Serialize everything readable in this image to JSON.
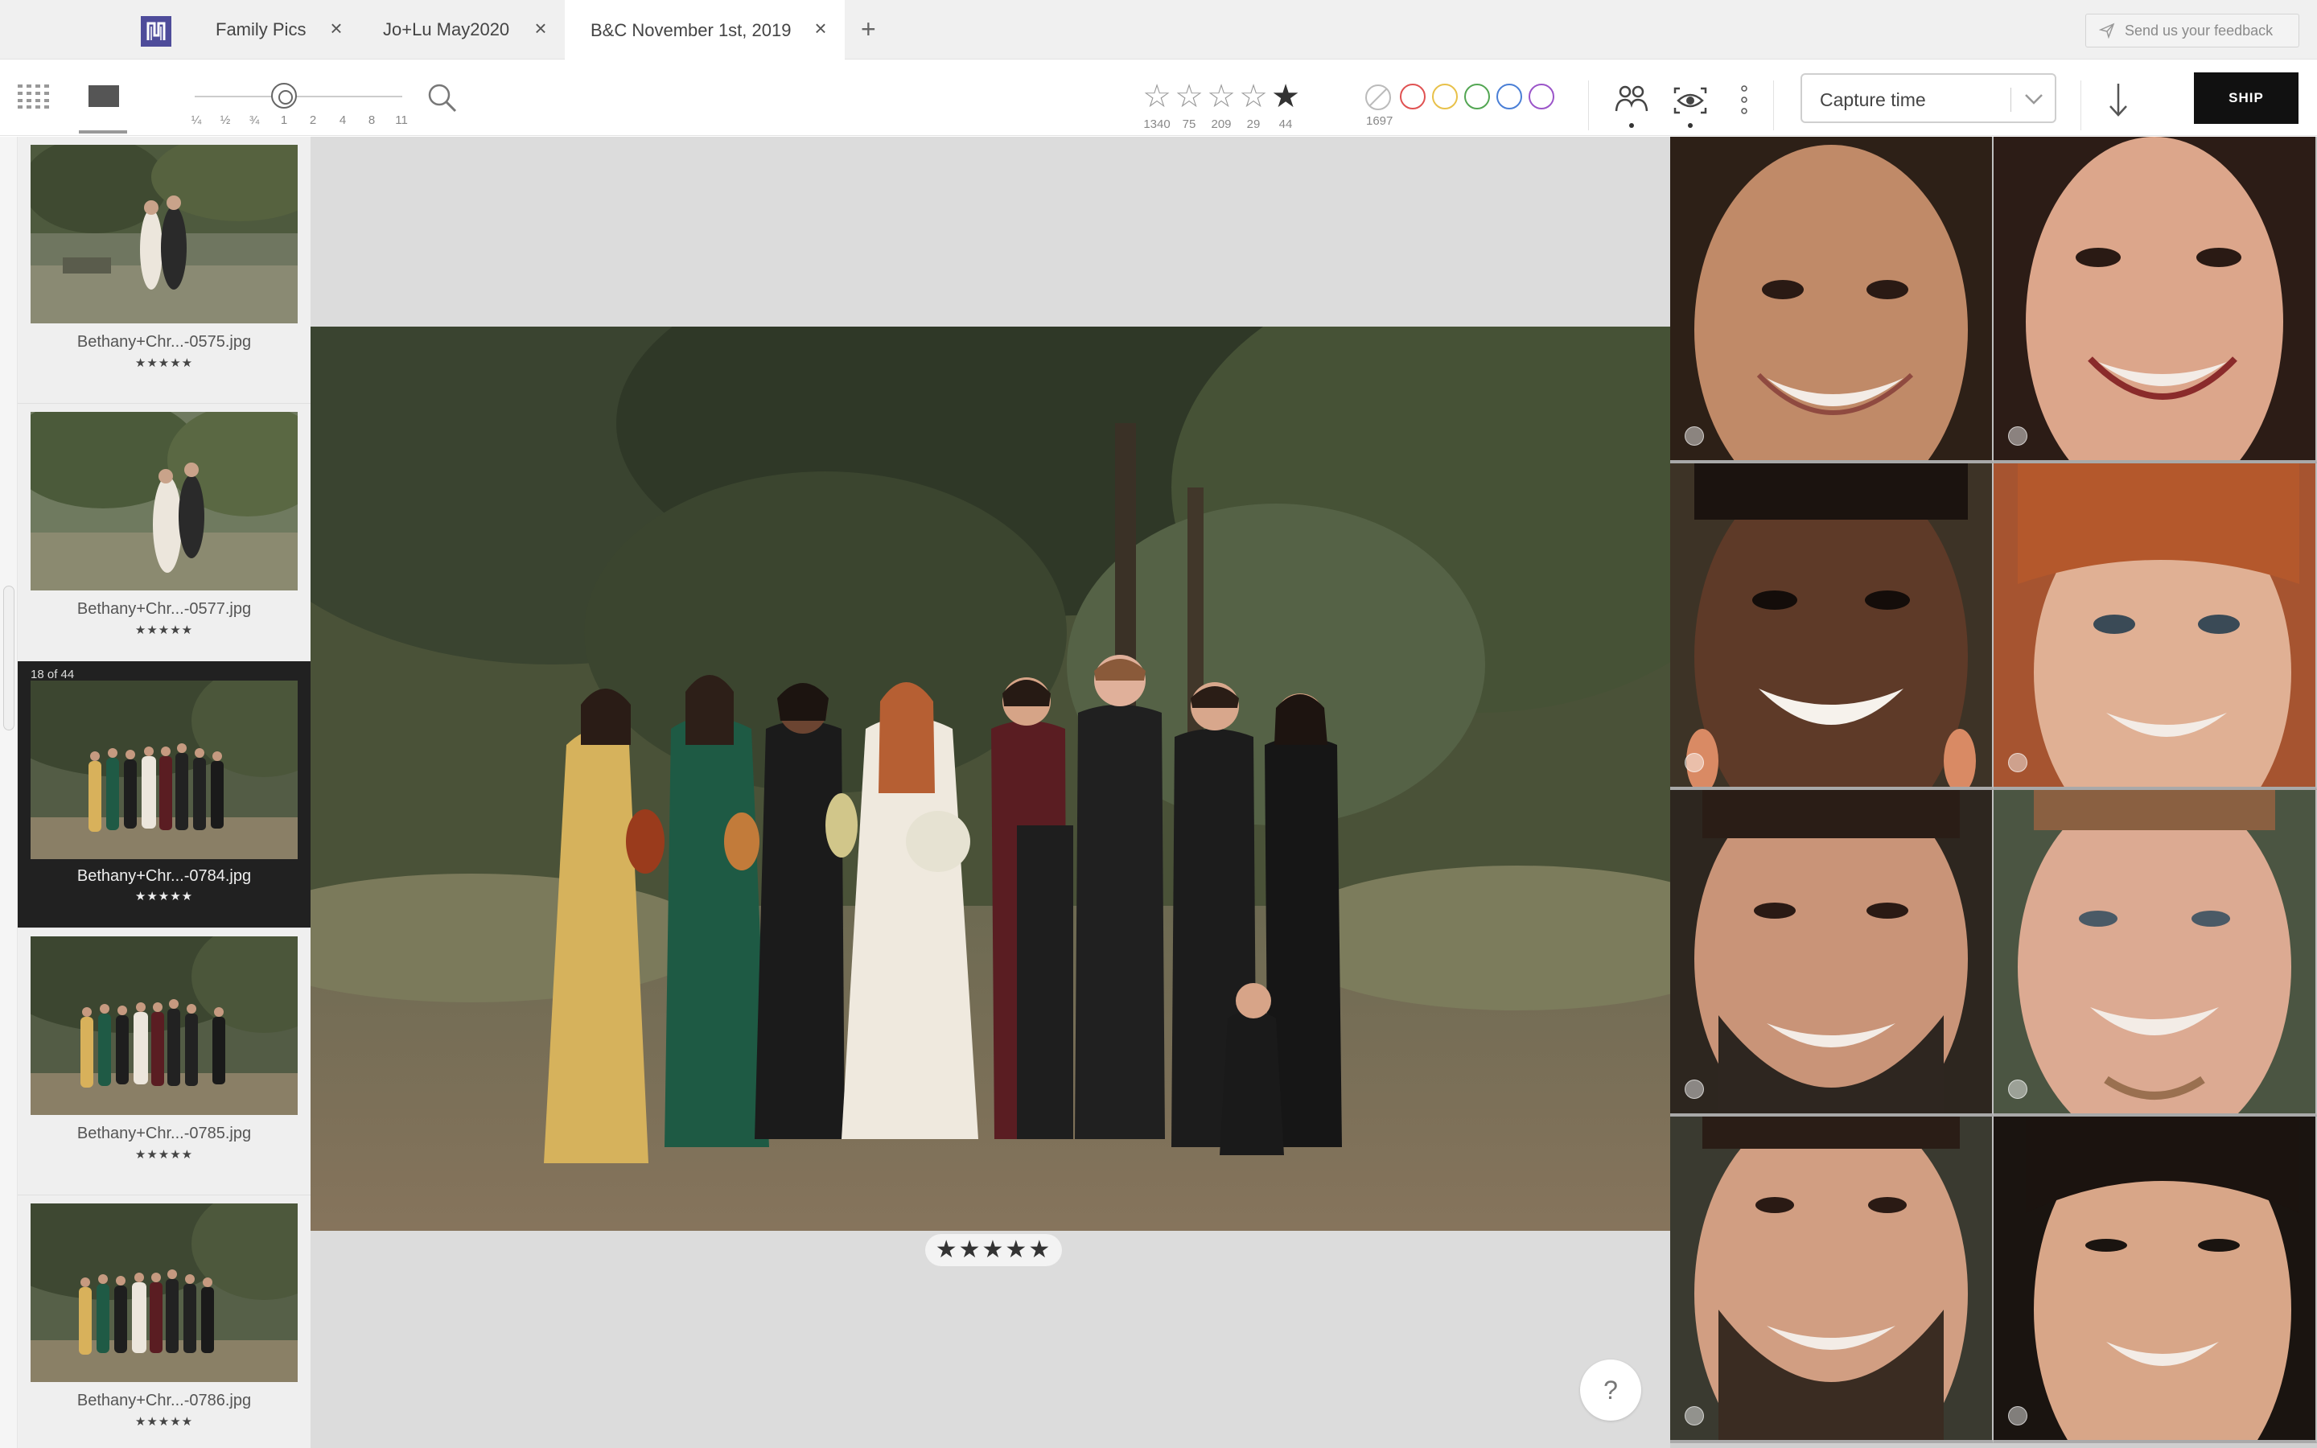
{
  "tabs": [
    {
      "label": "Family Pics",
      "active": false
    },
    {
      "label": "Jo+Lu May2020",
      "active": false
    },
    {
      "label": "B&C November 1st, 2019",
      "active": true
    }
  ],
  "feedback_label": "Send us your feedback",
  "zoom": {
    "labels": [
      "¼",
      "½",
      "¾",
      "1",
      "2",
      "4",
      "8",
      "11"
    ],
    "current": "1"
  },
  "rating_filters": [
    {
      "stars": "1",
      "count": "1340"
    },
    {
      "stars": "2",
      "count": "75"
    },
    {
      "stars": "3",
      "count": "209"
    },
    {
      "stars": "4",
      "count": "29"
    },
    {
      "stars": "5",
      "count": "44",
      "selected": true
    }
  ],
  "color_filters": {
    "no_color_count": "1697",
    "colors": [
      "#e05252",
      "#e8c14a",
      "#53a653",
      "#4a7fd6",
      "#9b55c9"
    ]
  },
  "sort": {
    "value": "Capture time"
  },
  "ship_label": "SHIP",
  "filmstrip": [
    {
      "name": "Bethany+Chr...-0575.jpg",
      "rating": "★★★★★",
      "selected": false
    },
    {
      "name": "Bethany+Chr...-0577.jpg",
      "rating": "★★★★★",
      "selected": false
    },
    {
      "name": "Bethany+Chr...-0784.jpg",
      "rating": "★★★★★",
      "selected": true,
      "badge": "18 of 44"
    },
    {
      "name": "Bethany+Chr...-0785.jpg",
      "rating": "★★★★★",
      "selected": false
    },
    {
      "name": "Bethany+Chr...-0786.jpg",
      "rating": "★★★★★",
      "selected": false
    }
  ],
  "viewer": {
    "rating": "★★★★★",
    "help_label": "?"
  },
  "icons": [
    "logo-icon",
    "close-icon",
    "plus-icon",
    "send-icon",
    "grid-icon",
    "single-view-icon",
    "search-icon",
    "star-icon",
    "no-color-icon",
    "people-icon",
    "eye-icon",
    "more-icon",
    "chevron-down-icon",
    "download-icon",
    "help-icon"
  ]
}
